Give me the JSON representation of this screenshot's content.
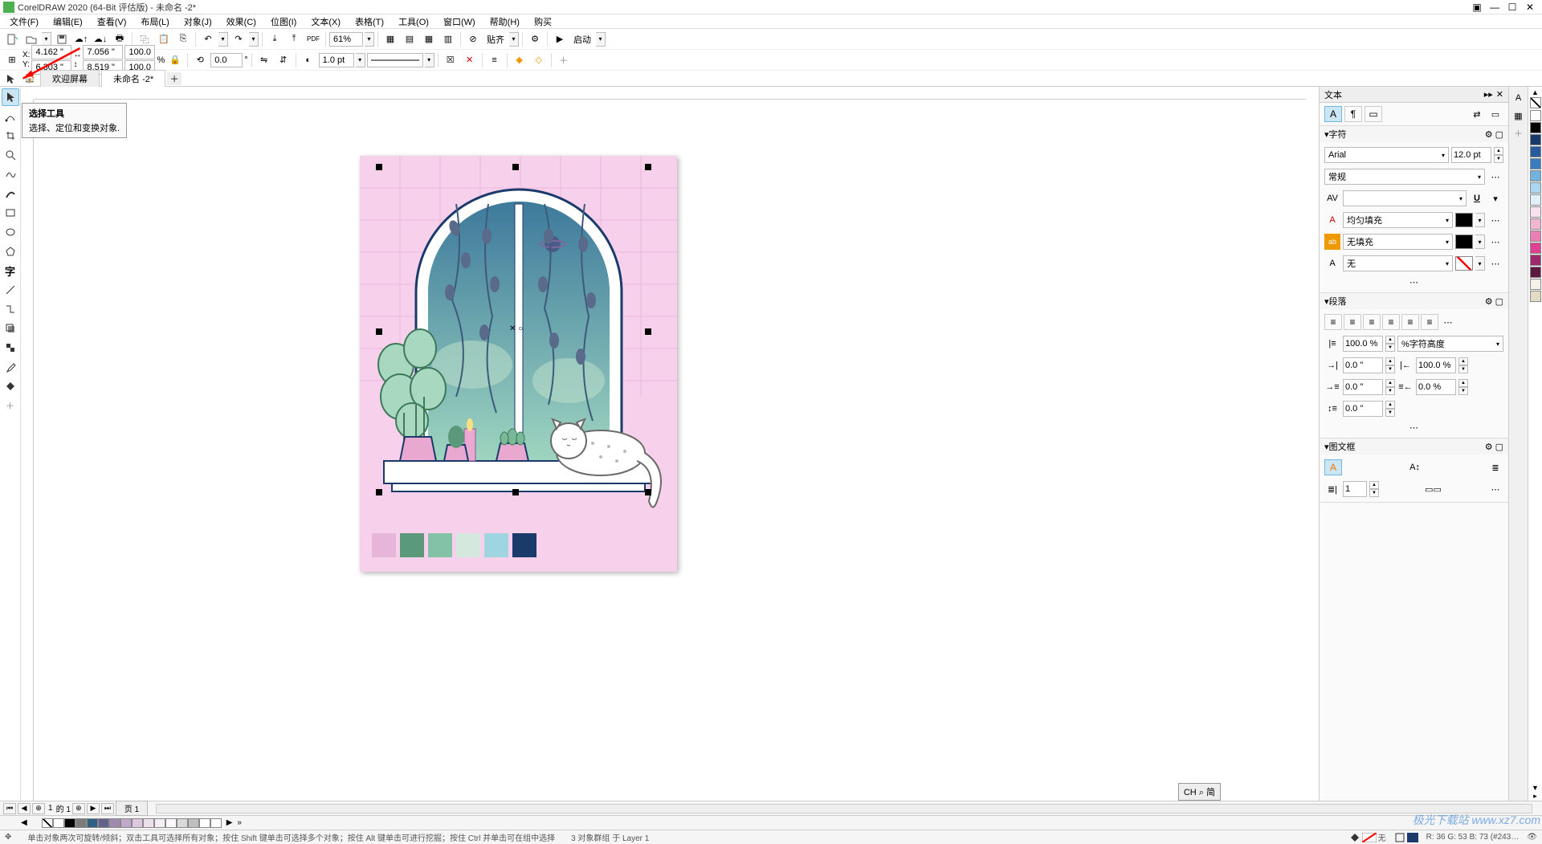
{
  "window": {
    "title": "CorelDRAW 2020 (64-Bit 评估版) - 未命名 -2*"
  },
  "menu": {
    "file": "文件(F)",
    "edit": "编辑(E)",
    "view": "查看(V)",
    "layout": "布局(L)",
    "object": "对象(J)",
    "effects": "效果(C)",
    "bitmap": "位图(I)",
    "text": "文本(X)",
    "table": "表格(T)",
    "tools": "工具(O)",
    "window": "窗口(W)",
    "help": "帮助(H)",
    "purchase": "购买"
  },
  "toolbar1": {
    "zoom": "61%",
    "snap": "贴齐",
    "launch": "启动"
  },
  "toolbar2": {
    "x_label": "X:",
    "y_label": "Y:",
    "x": "4.162 \"",
    "y": "6.303 \"",
    "w": "7.056 \"",
    "h": "8.519 \"",
    "scale_x": "100.0",
    "scale_y": "100.0",
    "percent": "%",
    "rotation": "0.0",
    "deg": "°",
    "outline_width": "1.0 pt"
  },
  "tabs": {
    "welcome": "欢迎屏幕",
    "doc": "未命名 -2*"
  },
  "tooltip": {
    "title": "选择工具",
    "desc": "选择、定位和变换对象."
  },
  "text_panel": {
    "title": "文本",
    "char_section": "字符",
    "font": "Arial",
    "size": "12.0 pt",
    "style": "常规",
    "fill_type": "均匀填充",
    "outline_fill": "无填充",
    "bg_fill": "无",
    "para_section": "段落",
    "line_spacing": "100.0 %",
    "char_height_unit": "%字符高度",
    "left_indent": "0.0 \"",
    "right_indent": "100.0 %",
    "first_line1": "0.0 \"",
    "first_line2": "0.0 %",
    "before_para": "0.0 \"",
    "frame_section": "图文框",
    "columns": "1"
  },
  "page_nav": {
    "page_count": "的 1",
    "page_current": "1",
    "page_tab": "页 1"
  },
  "status": {
    "hint": "单击对象两次可旋转/倾斜；双击工具可选择所有对象；按住 Shift 键单击可选择多个对象；按住 Alt 键单击可进行挖掘；按住 Ctrl 并单击可在组中选择",
    "selection": "3 对象群组 于 Layer 1",
    "fill_label": "无",
    "color_readout": "R: 36 G: 53 B: 73 (#243…"
  },
  "ime": "CH ⌕ 简",
  "watermark": "极光下载站\nwww.xz7.com",
  "colorbar_colors": [
    "#ffffff",
    "#000000",
    "#1a3a6b",
    "#275b9e",
    "#3b7cc0",
    "#72b2de",
    "#aad5ee",
    "#e0f0fa",
    "#f8e1ed",
    "#f2b6d3",
    "#ea7db4",
    "#df4093",
    "#9e2a6d",
    "#5d1a41",
    "#f4f2e8",
    "#e5dcc8"
  ],
  "doc_palette_colors": [
    "#ffffff",
    "#000000",
    "#7b7b7b",
    "#2f5f83",
    "#64618c",
    "#9f8bb0",
    "#c1a7c9",
    "#dec7df",
    "#ede0ec",
    "#f5eef4",
    "#faf8fa",
    "#d9d9d9",
    "#bfbfbf",
    "#ffffff",
    "#ffffff"
  ],
  "artboard_swatches": [
    "#e8b5da",
    "#5a9a7a",
    "#84c2a8",
    "#d4e8de",
    "#9ed5e0",
    "#1a3a6b"
  ]
}
